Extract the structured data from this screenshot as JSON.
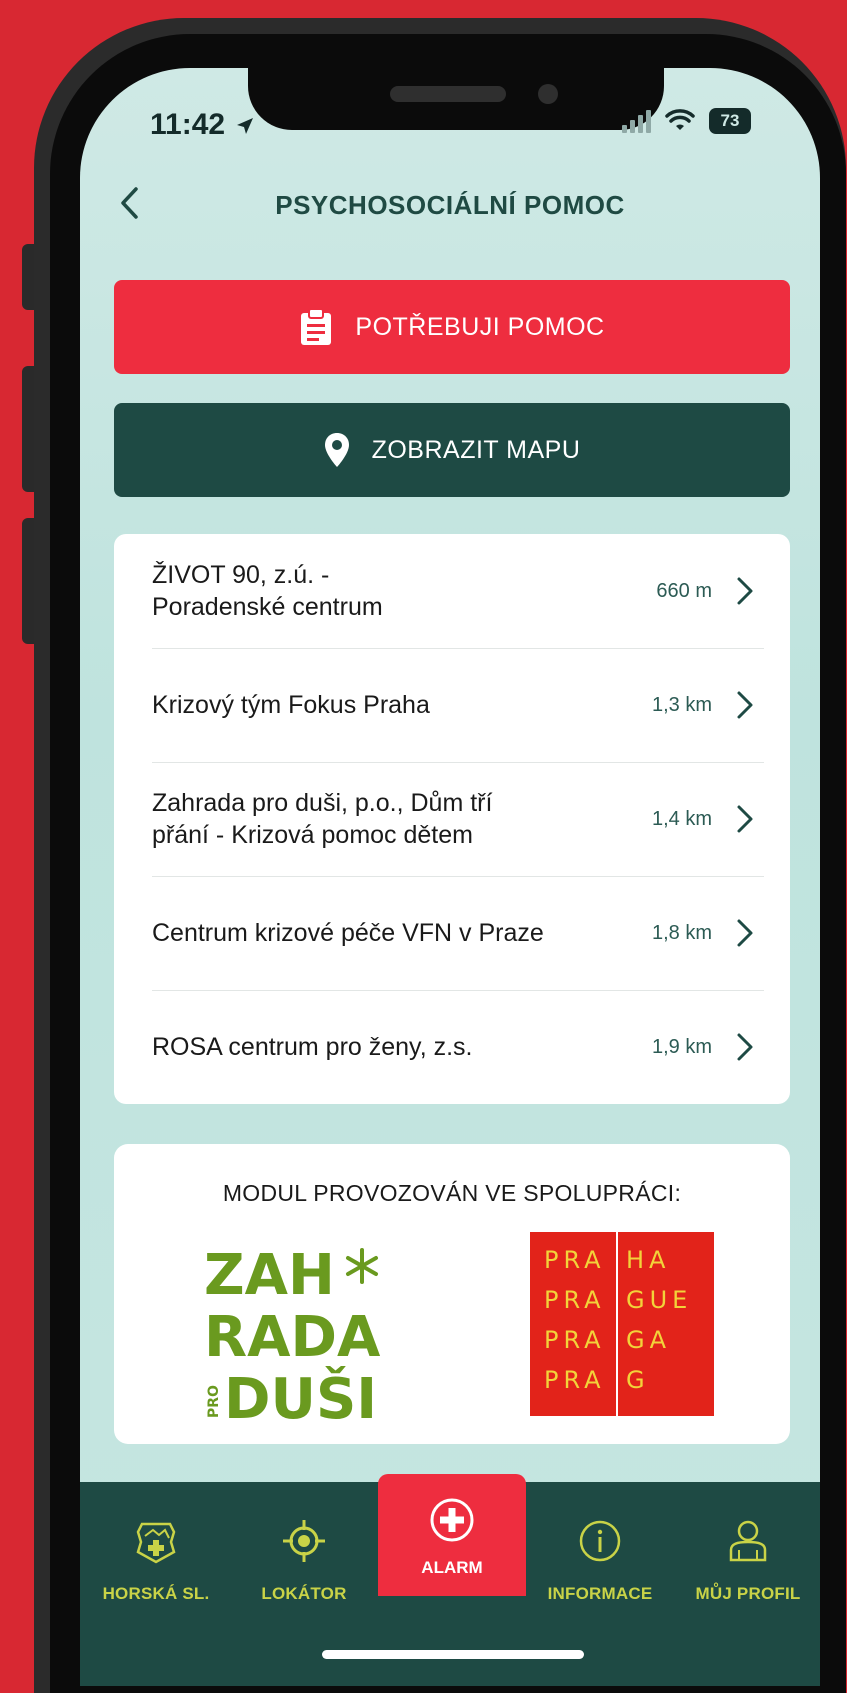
{
  "status_bar": {
    "time": "11:42",
    "battery": "73"
  },
  "header": {
    "title": "PSYCHOSOCIÁLNÍ POMOC",
    "back_icon": "chevron-left-icon"
  },
  "actions": {
    "help_label": "POTŘEBUJI POMOC",
    "map_label": "ZOBRAZIT MAPU"
  },
  "places": [
    {
      "name_line1": "ŽIVOT 90, z.ú. -",
      "name_line2": "Poradenské centrum",
      "distance": "660 m"
    },
    {
      "name_line1": "Krizový tým Fokus Praha",
      "name_line2": "",
      "distance": "1,3 km"
    },
    {
      "name_line1": "Zahrada pro duši, p.o., Dům tří",
      "name_line2": "přání - Krizová pomoc dětem",
      "distance": "1,4 km"
    },
    {
      "name_line1": "Centrum krizové péče VFN v Praze",
      "name_line2": "",
      "distance": "1,8 km"
    },
    {
      "name_line1": "ROSA centrum pro ženy, z.s.",
      "name_line2": "",
      "distance": "1,9 km"
    }
  ],
  "partners": {
    "title": "MODUL PROVOZOVÁN VE SPOLUPRÁCI:",
    "zahrada_logo": {
      "line1": "ZAH",
      "line2": "RADA",
      "line3": "DUŠI",
      "small": "PRO"
    },
    "praha_logo": {
      "left": [
        "PRA",
        "PRA",
        "PRA",
        "PRA"
      ],
      "right": [
        "HA",
        "GUE",
        "GA",
        "G"
      ]
    }
  },
  "tabs": [
    {
      "label": "HORSKÁ SL.",
      "icon": "mountain-rescue-badge-icon"
    },
    {
      "label": "LOKÁTOR",
      "icon": "crosshair-icon"
    },
    {
      "label": "ALARM",
      "icon": "medical-cross-icon",
      "active": true
    },
    {
      "label": "INFORMACE",
      "icon": "info-icon"
    },
    {
      "label": "MŮJ PROFIL",
      "icon": "user-icon"
    }
  ],
  "colors": {
    "background": "#d82832",
    "screen": "#c6e6e1",
    "primary_dark": "#1e4a44",
    "alert_red": "#ee2d3f",
    "tab_accent": "#c9d347",
    "zahrada_green": "#6a9a1f",
    "praha_red": "#e2231a",
    "praha_yellow": "#f2d33a"
  }
}
